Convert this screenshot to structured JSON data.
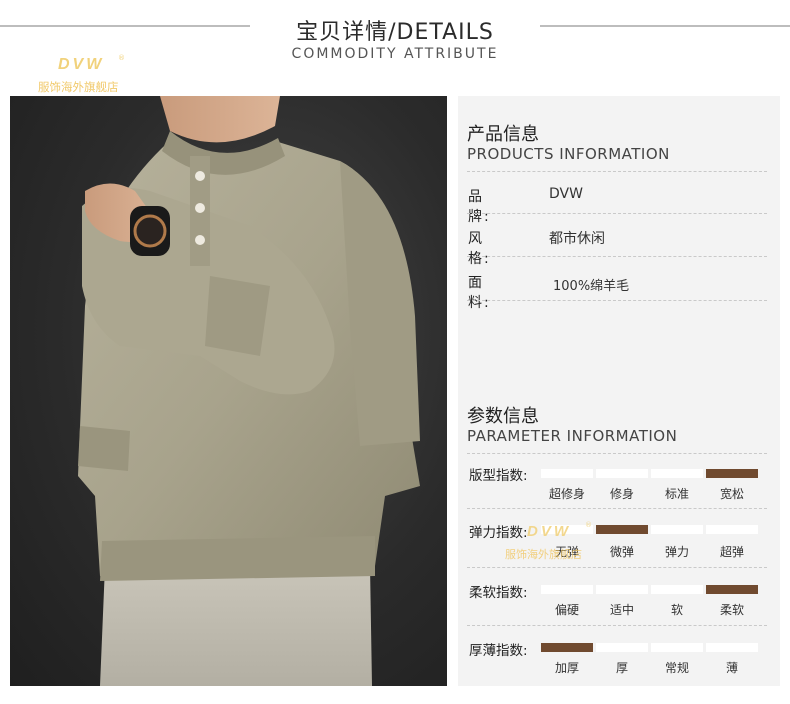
{
  "header": {
    "title": "宝贝详情/DETAILS",
    "subtitle": "COMMODITY ATTRIBUTE"
  },
  "logo": {
    "mark": "DVW",
    "registered": "®",
    "store_name": "服饰海外旗舰店"
  },
  "products": {
    "title_cn": "产品信息",
    "title_en": "PRODUCTS INFORMATION",
    "attributes": [
      {
        "label": "品牌",
        "value": "DVW"
      },
      {
        "label": "风格",
        "value": "都市休闲"
      },
      {
        "label": "面料",
        "value": "100%绵羊毛"
      }
    ]
  },
  "parameters": {
    "title_cn": "参数信息",
    "title_en": "PARAMETER INFORMATION",
    "scales": [
      {
        "label": "版型指数:",
        "options": [
          "超修身",
          "修身",
          "标准",
          "宽松"
        ],
        "selected": 3
      },
      {
        "label": "弹力指数:",
        "options": [
          "无弹",
          "微弹",
          "弹力",
          "超弹"
        ],
        "selected": 1
      },
      {
        "label": "柔软指数:",
        "options": [
          "偏硬",
          "适中",
          "软",
          "柔软"
        ],
        "selected": 3
      },
      {
        "label": "厚薄指数:",
        "options": [
          "加厚",
          "厚",
          "常规",
          "薄"
        ],
        "selected": 0
      }
    ]
  },
  "colors": {
    "accent": "#704a2f",
    "logo_gold": "#f1c96a",
    "sweater": "#a8a38c",
    "panel_bg": "#f3f3f3"
  }
}
